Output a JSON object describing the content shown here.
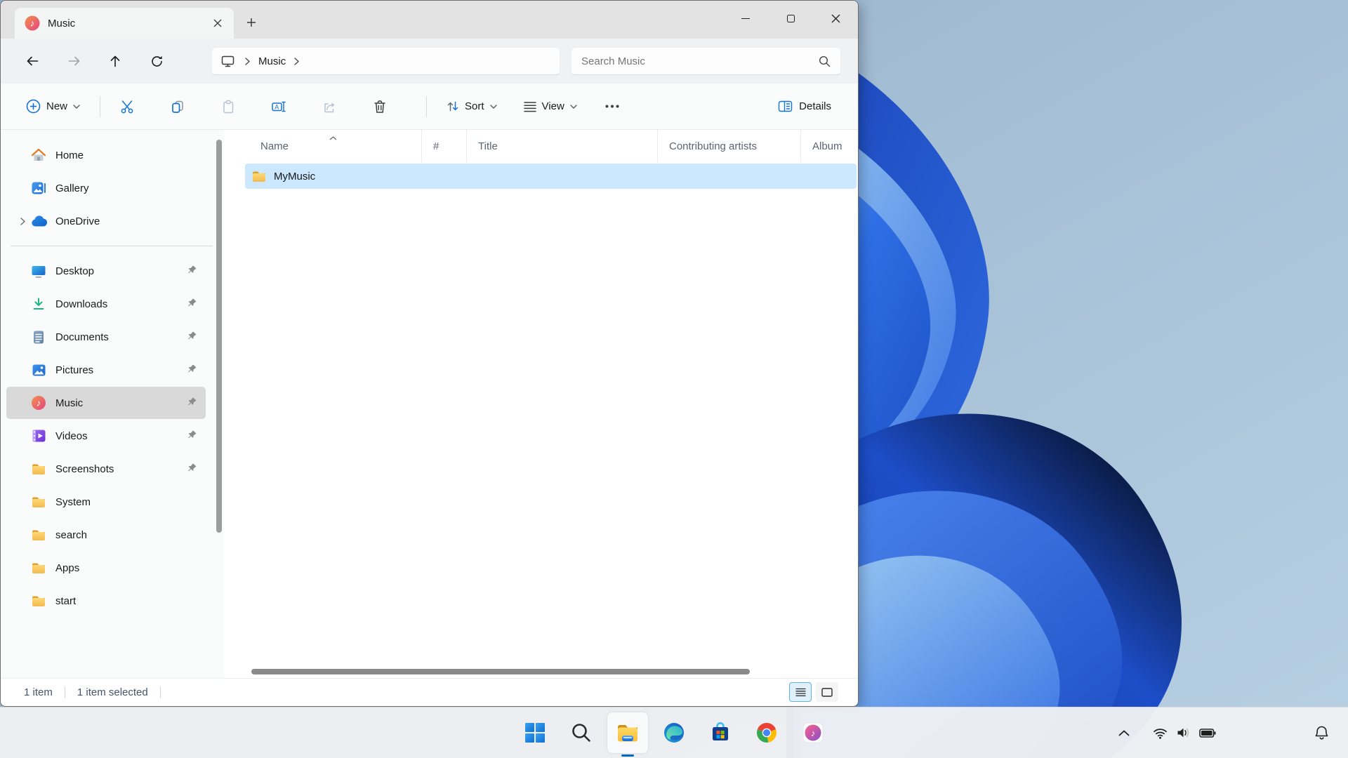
{
  "colors": {
    "accent": "#0067c0",
    "selection": "#cce8ff",
    "icon_blue": "#1574d4",
    "taskbar_bg": "#eef0f3"
  },
  "window": {
    "tab_title": "Music",
    "nav": {
      "breadcrumb_item": "Music",
      "search_placeholder": "Search Music"
    },
    "toolbar": {
      "new_label": "New",
      "sort_label": "Sort",
      "view_label": "View",
      "details_label": "Details"
    },
    "sidebar": {
      "items": [
        {
          "label": "Home",
          "icon": "home-icon",
          "pinned": false
        },
        {
          "label": "Gallery",
          "icon": "gallery-icon",
          "pinned": false
        },
        {
          "label": "OneDrive",
          "icon": "onedrive-icon",
          "pinned": false,
          "expandable": true
        },
        {
          "label": "Desktop",
          "icon": "desktop-icon",
          "pinned": true
        },
        {
          "label": "Downloads",
          "icon": "downloads-icon",
          "pinned": true
        },
        {
          "label": "Documents",
          "icon": "documents-icon",
          "pinned": true
        },
        {
          "label": "Pictures",
          "icon": "pictures-icon",
          "pinned": true
        },
        {
          "label": "Music",
          "icon": "music-icon",
          "pinned": true,
          "selected": true
        },
        {
          "label": "Videos",
          "icon": "videos-icon",
          "pinned": true
        },
        {
          "label": "Screenshots",
          "icon": "folder-icon",
          "pinned": true
        },
        {
          "label": "System",
          "icon": "folder-icon",
          "pinned": false
        },
        {
          "label": "search",
          "icon": "folder-icon",
          "pinned": false
        },
        {
          "label": "Apps",
          "icon": "folder-icon",
          "pinned": false
        },
        {
          "label": "start",
          "icon": "folder-icon",
          "pinned": false
        }
      ]
    },
    "list": {
      "columns": [
        "Name",
        "#",
        "Title",
        "Contributing artists",
        "Album"
      ],
      "rows": [
        {
          "name": "MyMusic",
          "icon": "folder-icon",
          "selected": true
        }
      ]
    },
    "status": {
      "count": "1 item",
      "selected": "1 item selected"
    }
  },
  "taskbar": {
    "icons": [
      {
        "name": "start"
      },
      {
        "name": "search"
      },
      {
        "name": "file-explorer",
        "active": true
      },
      {
        "name": "edge"
      },
      {
        "name": "microsoft-store"
      },
      {
        "name": "chrome"
      },
      {
        "name": "itunes"
      }
    ],
    "tray": [
      {
        "name": "chevron-up"
      },
      {
        "name": "wifi"
      },
      {
        "name": "volume"
      },
      {
        "name": "battery"
      },
      {
        "name": "notification-bell"
      }
    ]
  }
}
